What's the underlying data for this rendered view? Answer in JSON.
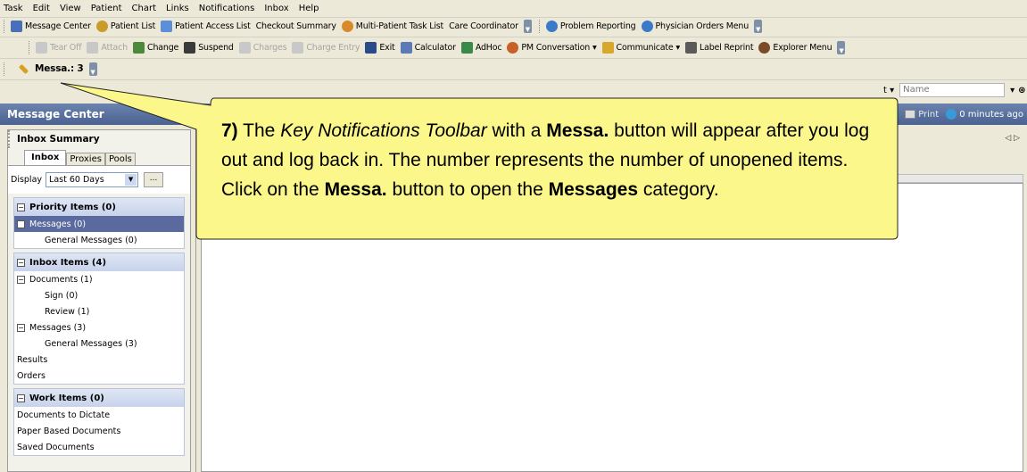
{
  "menu": [
    "Task",
    "Edit",
    "View",
    "Patient",
    "Chart",
    "Links",
    "Notifications",
    "Inbox",
    "Help"
  ],
  "toolbar1": {
    "items": [
      {
        "label": "Message Center",
        "icon": "message-center-icon",
        "color": "#4a6fb8"
      },
      {
        "label": "Patient List",
        "icon": "patient-list-icon",
        "color": "#c89b2b"
      },
      {
        "label": "Patient Access List",
        "icon": "patient-access-list-icon",
        "color": "#5b8fd8"
      },
      {
        "label": "Checkout Summary",
        "icon": "",
        "color": ""
      },
      {
        "label": "Multi-Patient Task List",
        "icon": "multi-patient-icon",
        "color": "#d88a2a"
      },
      {
        "label": "Care Coordinator",
        "icon": "",
        "color": ""
      }
    ],
    "items2": [
      {
        "label": "Problem Reporting",
        "icon": "problem-reporting-icon",
        "color": "#3a7ac8"
      },
      {
        "label": "Physician Orders Menu",
        "icon": "physician-orders-icon",
        "color": "#3a7ac8"
      }
    ]
  },
  "toolbar2": {
    "items": [
      {
        "label": "Tear Off",
        "icon": "tear-off-icon",
        "color": "#a0a0a0",
        "disabled": true
      },
      {
        "label": "Attach",
        "icon": "attach-icon",
        "color": "#a0a0a0",
        "disabled": true
      },
      {
        "label": "Change",
        "icon": "change-icon",
        "color": "#4a8a3a",
        "disabled": false
      },
      {
        "label": "Suspend",
        "icon": "suspend-icon",
        "color": "#3a3a3a",
        "disabled": false
      },
      {
        "label": "Charges",
        "icon": "charges-icon",
        "color": "#a0a0a0",
        "disabled": true
      },
      {
        "label": "Charge Entry",
        "icon": "charge-entry-icon",
        "color": "#a0a0a0",
        "disabled": true
      },
      {
        "label": "Exit",
        "icon": "exit-icon",
        "color": "#2a4a8a",
        "disabled": false
      },
      {
        "label": "Calculator",
        "icon": "calculator-icon",
        "color": "#5a7ab8",
        "disabled": false
      },
      {
        "label": "AdHoc",
        "icon": "adhoc-icon",
        "color": "#3a8a4a",
        "disabled": false
      },
      {
        "label": "PM Conversation",
        "icon": "pm-conversation-icon",
        "color": "#c8602a",
        "disabled": false
      },
      {
        "label": "Communicate",
        "icon": "communicate-icon",
        "color": "#d8a82a",
        "disabled": false
      },
      {
        "label": "Label Reprint",
        "icon": "label-reprint-icon",
        "color": "#5a5a5a",
        "disabled": false
      },
      {
        "label": "Explorer Menu",
        "icon": "explorer-menu-icon",
        "color": "#7a4a2a",
        "disabled": false
      }
    ]
  },
  "notifications": {
    "label": "Messa.: 3"
  },
  "search": {
    "label": "t",
    "placeholder": "Name"
  },
  "titlebar": {
    "title": "Message Center",
    "print": "Print",
    "refresh": "0 minutes ago"
  },
  "inbox": {
    "header": "Inbox Summary",
    "tabs": [
      "Inbox",
      "Proxies",
      "Pools"
    ],
    "display_label": "Display",
    "display_value": "Last 60 Days",
    "more": "...",
    "priority": {
      "title": "Priority Items (0)",
      "items": [
        "Messages (0)",
        "General Messages (0)"
      ]
    },
    "inbox_items": {
      "title": "Inbox Items (4)",
      "items": [
        "Documents (1)",
        "Sign (0)",
        "Review (1)",
        "Messages (3)",
        "General Messages (3)",
        "Results",
        "Orders"
      ]
    },
    "work": {
      "title": "Work Items (0)",
      "items": [
        "Documents to Dictate",
        "Paper Based Documents",
        "Saved Documents"
      ]
    }
  },
  "callout": {
    "step": "7)",
    "t1": "The",
    "toolbar_name": "Key Notifications Toolbar",
    "t2": "with a",
    "button": "Messa.",
    "t3": "button will appear after you log out and log back in.  The number represents the number of unopened items.  Click on the",
    "button2": "Messa.",
    "t4": "button to open the",
    "category": "Messages",
    "t5": "category."
  }
}
